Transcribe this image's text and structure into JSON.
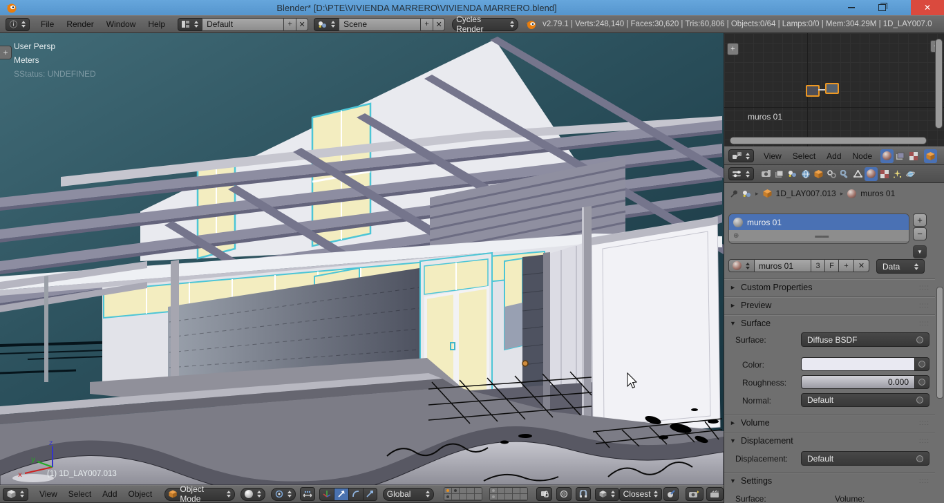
{
  "titlebar": {
    "title": "Blender* [D:\\PTE\\VIVIENDA MARRERO\\VIVIENDA MARRERO.blend]"
  },
  "infobar": {
    "menus": [
      "File",
      "Render",
      "Window",
      "Help"
    ],
    "layout_value": "Default",
    "scene_value": "Scene",
    "engine_value": "Cycles Render",
    "stats": "v2.79.1 | Verts:248,140 | Faces:30,620 | Tris:60,806 | Objects:0/64 | Lamps:0/0 | Mem:304.29M | 1D_LAY007.0"
  },
  "viewport": {
    "view_label": "User Persp",
    "units_label": "Meters",
    "sstatus_label": "SStatus: UNDEFINED",
    "object_label": "(1) 1D_LAY007.013",
    "axis": {
      "x": "x",
      "y": "y",
      "z": "z"
    }
  },
  "node_editor": {
    "menus": [
      "View",
      "Select",
      "Add",
      "Node"
    ],
    "node_label": "muros 01"
  },
  "properties": {
    "breadcrumb": {
      "object": "1D_LAY007.013",
      "material": "muros 01"
    },
    "slot": {
      "name": "muros 01"
    },
    "datablock": {
      "name": "muros 01",
      "users": "3",
      "fake": "F",
      "display": "Data"
    },
    "panels": {
      "custom_properties": "Custom Properties",
      "preview": "Preview",
      "surface": "Surface",
      "volume": "Volume",
      "displacement": "Displacement",
      "settings": "Settings"
    },
    "surface": {
      "surface_label": "Surface:",
      "surface_value": "Diffuse BSDF",
      "color_label": "Color:",
      "roughness_label": "Roughness:",
      "roughness_value": "0.000",
      "normal_label": "Normal:",
      "normal_value": "Default"
    },
    "displacement": {
      "label": "Displacement:",
      "value": "Default"
    },
    "settings": {
      "surface_label": "Surface:",
      "volume_label": "Volume:"
    }
  },
  "bottombar": {
    "menus": [
      "View",
      "Select",
      "Add",
      "Object"
    ],
    "mode_value": "Object Mode",
    "orientation_value": "Global",
    "snap_target_value": "Closest"
  },
  "colors": {
    "accent_blue": "#4a71b4",
    "select_orange": "#ee9822",
    "titlebar_blue": "#5b9cd5",
    "close_red": "#da4a3e",
    "viewport_teal": "#2c505b",
    "window_cream": "#f3edc0",
    "frame_cyan": "#4cc5d6"
  }
}
